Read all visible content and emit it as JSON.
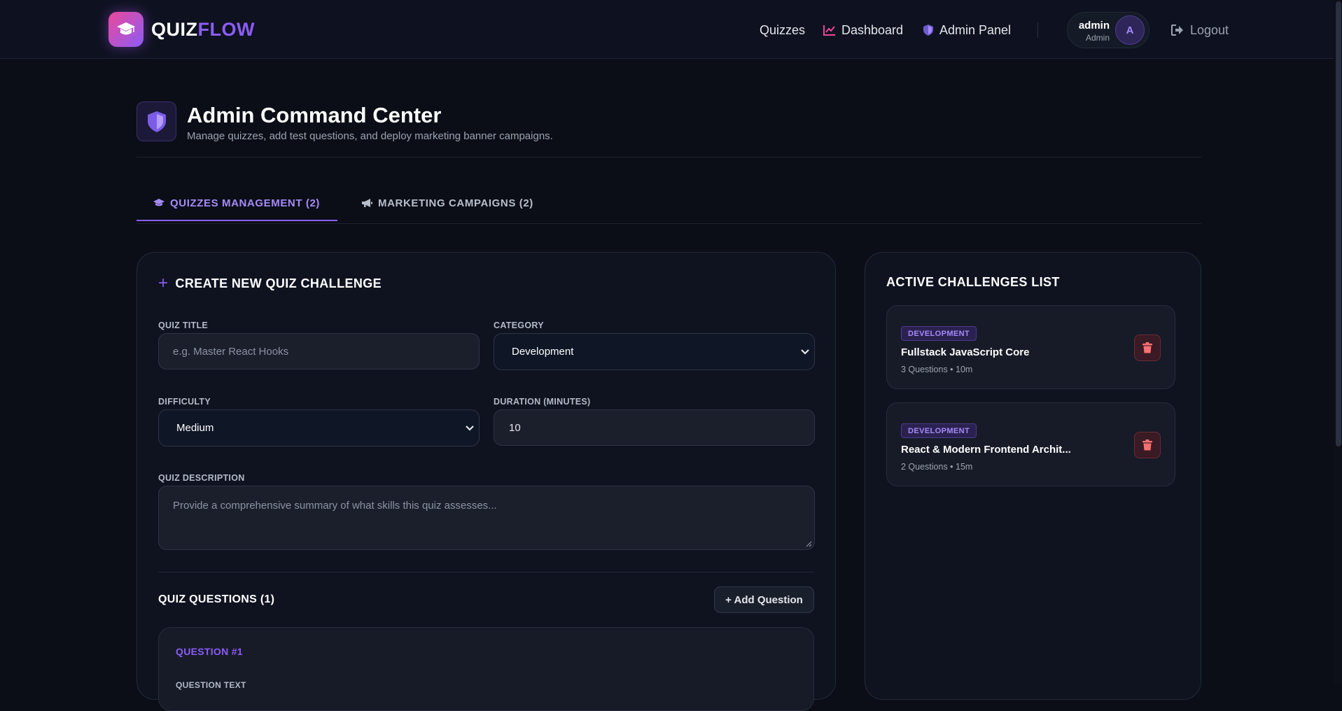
{
  "brand": {
    "name_part1": "QUIZ",
    "name_part2": "FLOW",
    "logo_icon": "graduation-cap-icon"
  },
  "nav": {
    "quizzes": "Quizzes",
    "dashboard": "Dashboard",
    "admin_panel": "Admin Panel",
    "logout": "Logout"
  },
  "user": {
    "name": "admin",
    "role": "Admin",
    "avatar_initial": "A"
  },
  "page": {
    "title": "Admin Command Center",
    "subtitle": "Manage quizzes, add test questions, and deploy marketing banner campaigns."
  },
  "tabs": [
    {
      "label": "QUIZZES MANAGEMENT (2)",
      "icon": "graduation-cap-icon",
      "active": true
    },
    {
      "label": "MARKETING CAMPAIGNS (2)",
      "icon": "megaphone-icon",
      "active": false
    }
  ],
  "create_form": {
    "section_title": "CREATE NEW QUIZ CHALLENGE",
    "quiz_title": {
      "label": "QUIZ TITLE",
      "value": "",
      "placeholder": "e.g. Master React Hooks"
    },
    "category": {
      "label": "CATEGORY",
      "selected": "Development"
    },
    "difficulty": {
      "label": "DIFFICULTY",
      "selected": "Medium"
    },
    "duration": {
      "label": "DURATION (MINUTES)",
      "value": "10"
    },
    "description": {
      "label": "QUIZ DESCRIPTION",
      "value": "",
      "placeholder": "Provide a comprehensive summary of what skills this quiz assesses..."
    },
    "questions_title": "QUIZ QUESTIONS (1)",
    "add_question_label": "+ Add Question",
    "question_1": {
      "label": "QUESTION #1",
      "text_label": "QUESTION TEXT"
    }
  },
  "active_list": {
    "section_title": "ACTIVE CHALLENGES LIST",
    "items": [
      {
        "badge": "DEVELOPMENT",
        "title": "Fullstack JavaScript Core",
        "meta": "3 Questions • 10m"
      },
      {
        "badge": "DEVELOPMENT",
        "title": "React & Modern Frontend Archit...",
        "meta": "2 Questions • 15m"
      }
    ]
  },
  "colors": {
    "background": "#0b0e17",
    "accent": "#8b5cf6",
    "accent_pink": "#ec4899",
    "danger": "#f87171"
  }
}
